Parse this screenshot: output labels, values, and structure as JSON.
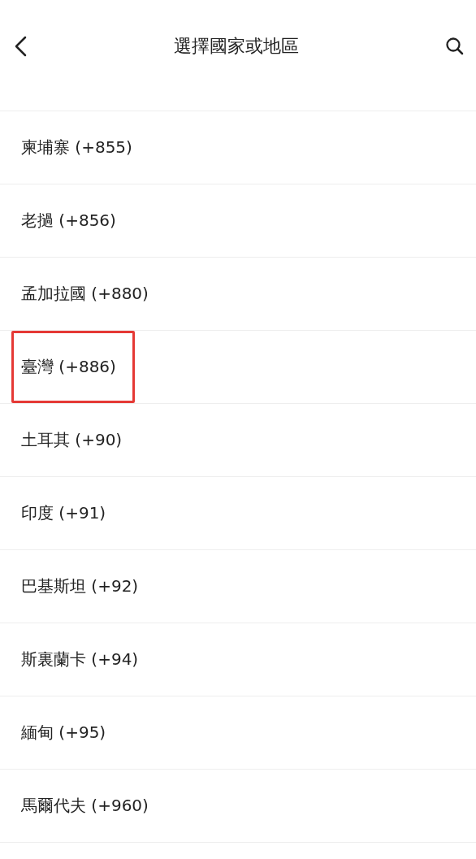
{
  "header": {
    "title": "選擇國家或地區"
  },
  "countries": [
    {
      "label": "柬埔寨 (+855)",
      "highlighted": false
    },
    {
      "label": "老撾 (+856)",
      "highlighted": false
    },
    {
      "label": "孟加拉國 (+880)",
      "highlighted": false
    },
    {
      "label": "臺灣 (+886)",
      "highlighted": true
    },
    {
      "label": "土耳其 (+90)",
      "highlighted": false
    },
    {
      "label": "印度 (+91)",
      "highlighted": false
    },
    {
      "label": "巴基斯坦 (+92)",
      "highlighted": false
    },
    {
      "label": "斯裏蘭卡 (+94)",
      "highlighted": false
    },
    {
      "label": "緬甸 (+95)",
      "highlighted": false
    },
    {
      "label": "馬爾代夫 (+960)",
      "highlighted": false
    }
  ]
}
